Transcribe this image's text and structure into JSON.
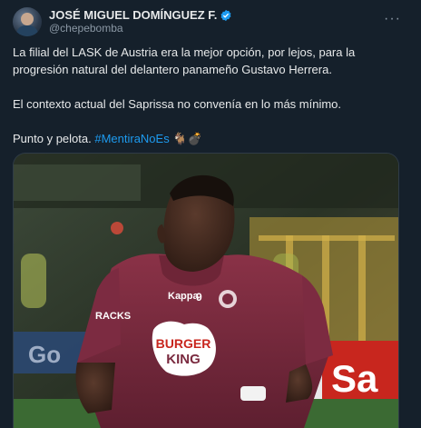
{
  "author": {
    "display_name": "JOSÉ MIGUEL DOMÍNGUEZ F.",
    "handle": "@chepebomba"
  },
  "more_label": "···",
  "tweet": {
    "paragraph_1": "La filial del LASK de Austria era la mejor opción, por lejos, para la progresión natural del delantero panameño Gustavo Herrera.",
    "paragraph_2": "El contexto actual del Saprissa no convenía en lo más mínimo.",
    "paragraph_3_text": "Punto y pelota. ",
    "hashtag": "#MentiraNoEs",
    "emojis": "🐐💣"
  },
  "media": {
    "jersey_number": "9",
    "sponsor_line1": "BURGER",
    "sponsor_line2": "KING",
    "chest_brand": "Kappa",
    "sleeve_text": "RACKS",
    "board_text": "Sa",
    "left_board_text": "Go"
  },
  "colors": {
    "background": "#15202b",
    "text": "#e7e9ea",
    "secondary": "#8b98a5",
    "link": "#1d9bf0",
    "verified": "#1d9bf0",
    "jersey": "#7a2a3f"
  }
}
